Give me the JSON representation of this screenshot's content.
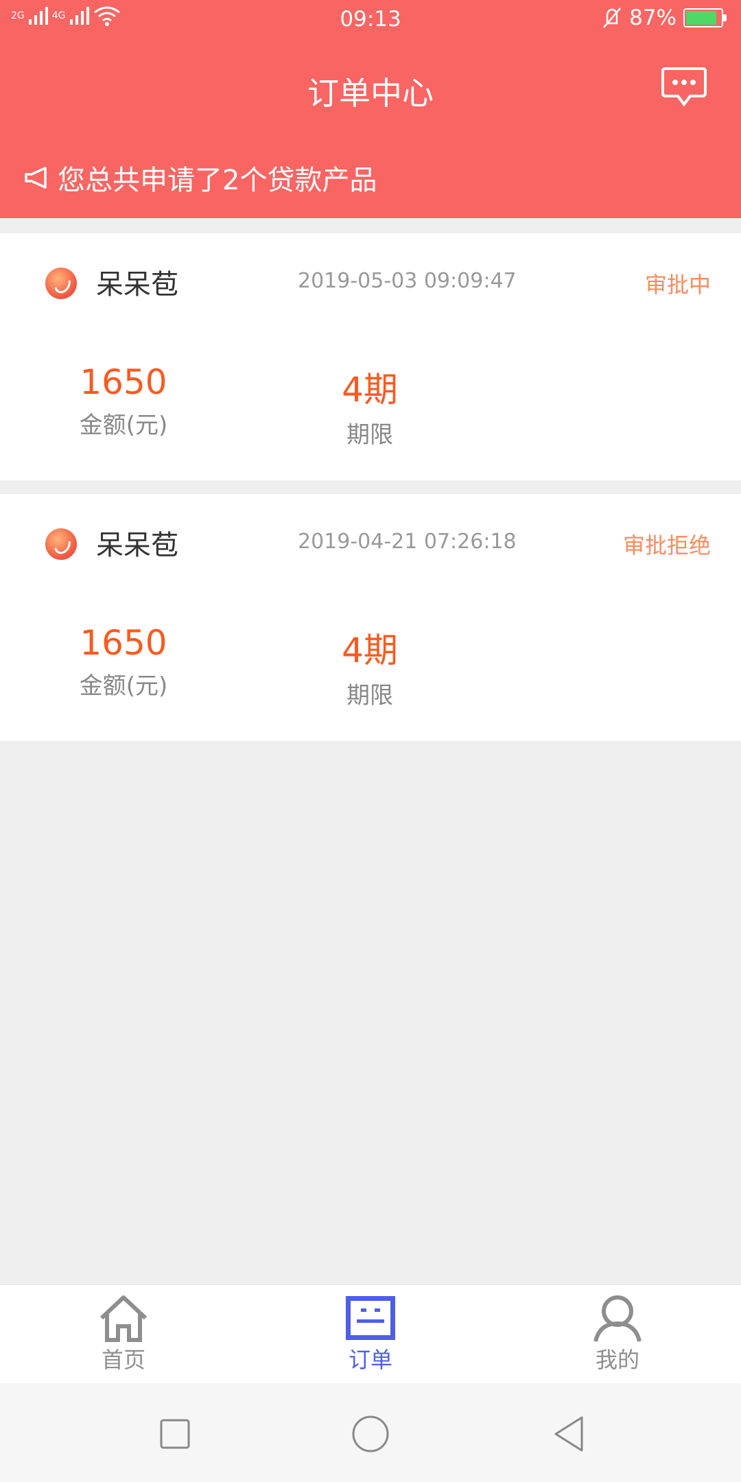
{
  "status_bar": {
    "signal_left": "2G",
    "signal_right": "4G",
    "time": "09:13",
    "battery": "87%",
    "battery_level": 0.87,
    "icons": [
      "signal-icon",
      "wifi-icon",
      "mute-bell-icon",
      "battery-icon"
    ]
  },
  "header": {
    "title": "订单中心",
    "message_icon": "chat-bubble-icon",
    "notice_icon": "megaphone-icon",
    "notice": "您总共申请了2个贷款产品",
    "color": "#f86562"
  },
  "orders": [
    {
      "name": "呆呆苞",
      "date": "2019-05-03 09:09:47",
      "status": "审批中",
      "amount": "1650",
      "amount_label": "金额(元)",
      "term": "4期",
      "term_label": "期限"
    },
    {
      "name": "呆呆苞",
      "date": "2019-04-21 07:26:18",
      "status": "审批拒绝",
      "amount": "1650",
      "amount_label": "金额(元)",
      "term": "4期",
      "term_label": "期限"
    }
  ],
  "tabs": [
    {
      "label": "首页",
      "icon": "home-icon"
    },
    {
      "label": "订单",
      "icon": "order-icon",
      "active": true
    },
    {
      "label": "我的",
      "icon": "profile-icon"
    }
  ],
  "accent_color": "#4f5ee6",
  "value_color": "#f95a1f"
}
